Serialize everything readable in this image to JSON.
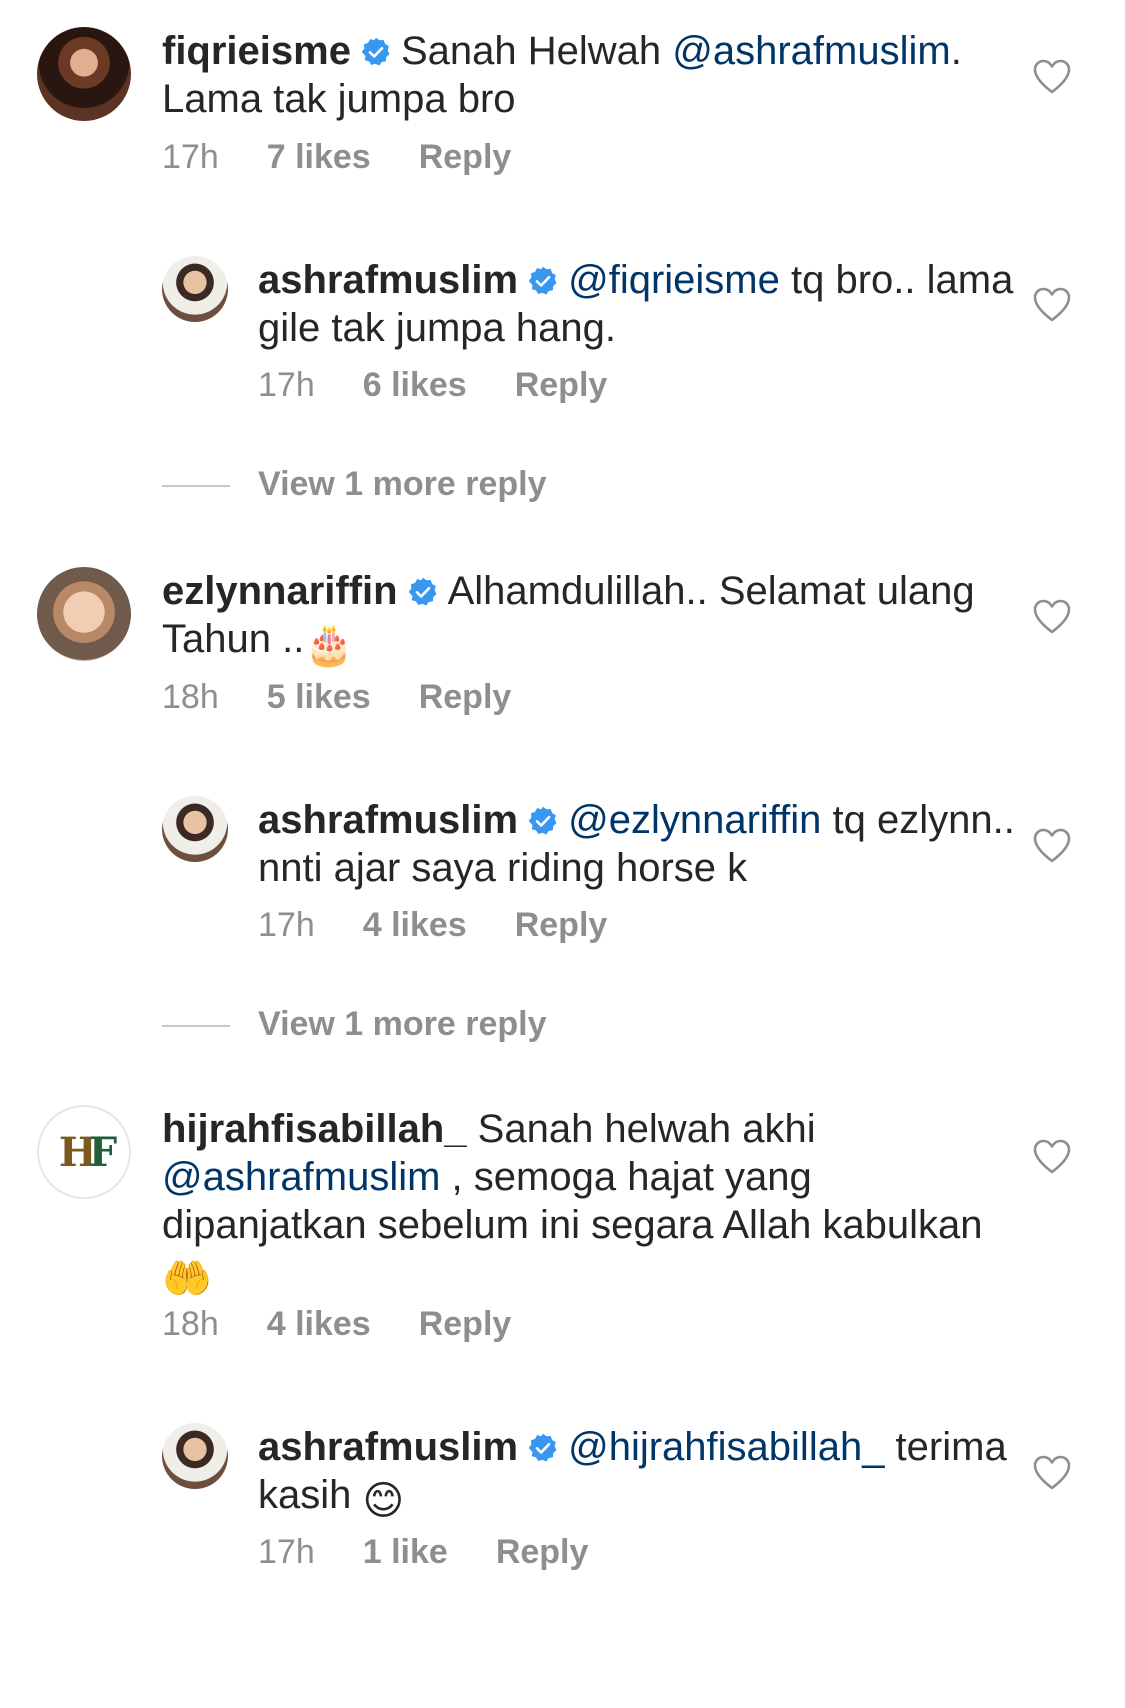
{
  "comments": [
    {
      "username": "fiqrieisme",
      "text_parts": [
        "Sanah Helwah "
      ],
      "mention": "@ashrafmuslim",
      "text_after": ". Lama tak jumpa bro",
      "time": "17h",
      "likes": "7 likes",
      "reply": "Reply",
      "replies": [
        {
          "username": "ashrafmuslim",
          "mention": "@fiqrieisme",
          "text": " tq bro.. lama gile tak jumpa hang.",
          "time": "17h",
          "likes": "6 likes",
          "reply": "Reply"
        }
      ],
      "view_more": "View 1 more reply"
    },
    {
      "username": "ezlynnariffin",
      "text": "Alhamdulillah.. Selamat ulang Tahun ..",
      "emoji": "🎂",
      "time": "18h",
      "likes": "5 likes",
      "reply": "Reply",
      "replies": [
        {
          "username": "ashrafmuslim",
          "mention": "@ezlynnariffin",
          "text": " tq ezlynn.. nnti ajar saya riding horse k",
          "time": "17h",
          "likes": "4 likes",
          "reply": "Reply"
        }
      ],
      "view_more": "View 1 more reply"
    },
    {
      "username": "hijrahfisabillah_",
      "text_before": " Sanah helwah akhi ",
      "mention": "@ashrafmuslim",
      "text_after": " , semoga hajat yang dipanjatkan sebelum ini segara Allah kabulkan ",
      "emoji": "🤲",
      "time": "18h",
      "likes": "4 likes",
      "reply": "Reply",
      "replies": [
        {
          "username": "ashrafmuslim",
          "mention": "@hijrahfisabillah_",
          "text": " terima kasih ",
          "emoji": "😊",
          "time": "17h",
          "likes": "1 like",
          "reply": "Reply"
        }
      ]
    }
  ],
  "colors": {
    "verified": "#3897f0",
    "mention": "#003569",
    "meta": "#8e8e8e"
  },
  "icons": {
    "like": "heart-outline-icon",
    "verified": "verified-badge-icon"
  }
}
